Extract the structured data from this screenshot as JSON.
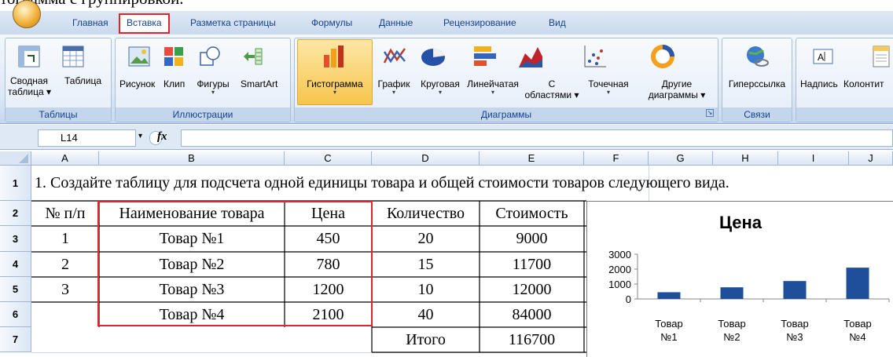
{
  "caption": "тограмма с группировкой.",
  "tabs": [
    "Главная",
    "Вставка",
    "Разметка страницы",
    "Формулы",
    "Данные",
    "Рецензирование",
    "Вид"
  ],
  "ribbon": {
    "groups": [
      "Таблицы",
      "Иллюстрации",
      "Диаграммы",
      "Связи"
    ],
    "buttons": {
      "pivot_line1": "Сводная",
      "pivot_line2": "таблица",
      "table": "Таблица",
      "picture": "Рисунок",
      "clip": "Клип",
      "shapes": "Фигуры",
      "smartart": "SmartArt",
      "histogram": "Гистограмма",
      "graph": "График",
      "pie": "Круговая",
      "bar": "Линейчатая",
      "area_line1": "С",
      "area_line2": "областями",
      "scatter": "Точечная",
      "other_line1": "Другие",
      "other_line2": "диаграммы",
      "hyperlink": "Гиперссылка",
      "textbox": "Надпись",
      "header": "Колонтит"
    },
    "dropdown_arrow": "▾"
  },
  "formula_bar": {
    "name_box": "L14",
    "fx": "fx",
    "value": ""
  },
  "columns": [
    "A",
    "B",
    "C",
    "D",
    "E",
    "F",
    "G",
    "H",
    "I",
    "J"
  ],
  "rows": [
    "1",
    "2",
    "3",
    "4",
    "5",
    "6",
    "7"
  ],
  "sheet": {
    "title": "1. Создайте таблицу для подсчета одной единицы товара и общей стоимости товаров следующего вида.",
    "headers": [
      "№ п/п",
      "Наименование товара",
      "Цена",
      "Количество",
      "Стоимость"
    ],
    "data_rows": [
      [
        "1",
        "Товар №1",
        "450",
        "20",
        "9000"
      ],
      [
        "2",
        "Товар №2",
        "780",
        "15",
        "11700"
      ],
      [
        "3",
        "Товар №3",
        "1200",
        "10",
        "12000"
      ],
      [
        "",
        "Товар №4",
        "2100",
        "40",
        "84000"
      ]
    ],
    "total_label": "Итого",
    "total_value": "116700"
  },
  "colors": {
    "accent": "#e0262a",
    "bar": "#1f4e9a",
    "ribbon_text": "#15428b"
  },
  "chart_data": {
    "type": "bar",
    "title": "Цена",
    "categories": [
      "Товар №1",
      "Товар №2",
      "Товар №3",
      "Товар №4"
    ],
    "values": [
      450,
      780,
      1200,
      2100
    ],
    "ylim": [
      0,
      3000
    ],
    "yticks": [
      "0",
      "1000",
      "2000",
      "3000"
    ],
    "xlabel": "",
    "ylabel": "",
    "legend": "none"
  }
}
